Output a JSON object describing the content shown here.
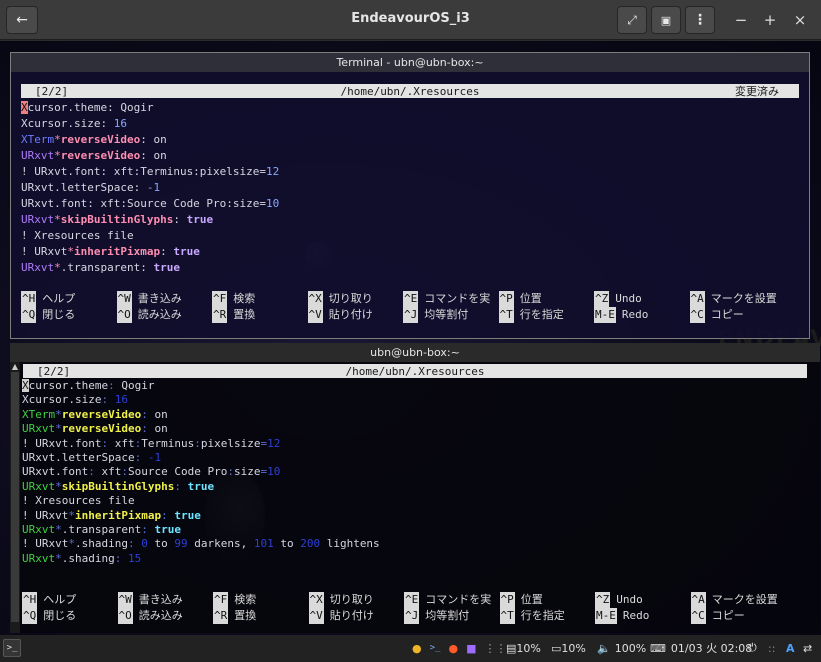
{
  "window": {
    "title": "EndeavourOS_i3",
    "back_icon": "back-arrow-icon",
    "fullscreen_icon": "expand-icon",
    "screenshot_icon": "window-icon",
    "menu_icon": "kebab-menu-icon",
    "minimize": "−",
    "maximize": "+",
    "close": "×"
  },
  "terminal1": {
    "title": "Terminal - ubn@ubn-box:~",
    "nano_buffer": "[2/2]",
    "nano_path": "/home/ubn/.Xresources",
    "nano_status": "変更済み",
    "lines": [
      [
        {
          "t": "X",
          "c": "cursor"
        },
        {
          "t": "cursor.theme: Qogir",
          "c": "w"
        }
      ],
      [
        {
          "t": "Xcursor.size: ",
          "c": "w"
        },
        {
          "t": "16",
          "c": "num"
        }
      ],
      [
        {
          "t": "XTerm",
          "c": "blue"
        },
        {
          "t": "*",
          "c": "pink"
        },
        {
          "t": "reverseVideo",
          "c": "pinkb"
        },
        {
          "t": ": on",
          "c": "w"
        }
      ],
      [
        {
          "t": "URxvt",
          "c": "purple"
        },
        {
          "t": "*",
          "c": "pink"
        },
        {
          "t": "reverseVideo",
          "c": "pinkb"
        },
        {
          "t": ": on",
          "c": "w"
        }
      ],
      [
        {
          "t": "! URxvt.font: xft:Terminus:pixelsize=",
          "c": "w"
        },
        {
          "t": "12",
          "c": "num"
        }
      ],
      [
        {
          "t": "URxvt.letterSpace: ",
          "c": "w"
        },
        {
          "t": "-1",
          "c": "num"
        }
      ],
      [
        {
          "t": "URxvt.font: xft:Source Code Pro:size=",
          "c": "w"
        },
        {
          "t": "10",
          "c": "num"
        }
      ],
      [
        {
          "t": "URxvt",
          "c": "purple"
        },
        {
          "t": "*",
          "c": "pink"
        },
        {
          "t": "skipBuiltinGlyphs",
          "c": "pinkb"
        },
        {
          "t": ": ",
          "c": "w"
        },
        {
          "t": "true",
          "c": "lilacb"
        }
      ],
      [
        {
          "t": "! Xresources file",
          "c": "w"
        }
      ],
      [
        {
          "t": "! URxvt",
          "c": "w"
        },
        {
          "t": "*",
          "c": "pink"
        },
        {
          "t": "inheritPixmap",
          "c": "pinkb"
        },
        {
          "t": ": ",
          "c": "w"
        },
        {
          "t": "true",
          "c": "lilacb"
        }
      ],
      [
        {
          "t": "URxvt",
          "c": "purple"
        },
        {
          "t": "*",
          "c": "pink"
        },
        {
          "t": ".transparent: ",
          "c": "w"
        },
        {
          "t": "true",
          "c": "lilacb"
        }
      ]
    ],
    "shortcuts": [
      [
        [
          "^H",
          "ヘルプ"
        ],
        [
          "^W",
          "書き込み"
        ],
        [
          "^F",
          "検索"
        ],
        [
          "^X",
          "切り取り"
        ],
        [
          "^E",
          "コマンドを実"
        ],
        [
          "^P",
          "位置"
        ],
        [
          "^Z",
          "Undo"
        ],
        [
          "^A",
          "マークを設置"
        ]
      ],
      [
        [
          "^Q",
          "閉じる"
        ],
        [
          "^O",
          "読み込み"
        ],
        [
          "^R",
          "置換"
        ],
        [
          "^V",
          "貼り付け"
        ],
        [
          "^J",
          "均等割付"
        ],
        [
          "^T",
          "行を指定"
        ],
        [
          "M-E",
          "Redo"
        ],
        [
          "^C",
          "コピー"
        ]
      ]
    ]
  },
  "terminal2": {
    "title": "ubn@ubn-box:~",
    "nano_buffer": "[2/2]",
    "nano_path": "/home/ubn/.Xresources",
    "lines": [
      [
        {
          "t": "X",
          "c": "cursor2"
        },
        {
          "t": "cursor.theme",
          "c": "w"
        },
        {
          "t": ":",
          "c": "dim"
        },
        {
          "t": " Qogir",
          "c": "w"
        }
      ],
      [
        {
          "t": "Xcursor.size",
          "c": "w"
        },
        {
          "t": ": ",
          "c": "dim"
        },
        {
          "t": "16",
          "c": "dblue"
        }
      ],
      [
        {
          "t": "XTerm",
          "c": "green"
        },
        {
          "t": "*",
          "c": "dim"
        },
        {
          "t": "reverseVideo",
          "c": "yellowb"
        },
        {
          "t": ":",
          "c": "dim"
        },
        {
          "t": " on",
          "c": "w"
        }
      ],
      [
        {
          "t": "URxvt",
          "c": "green"
        },
        {
          "t": "*",
          "c": "dim"
        },
        {
          "t": "reverseVideo",
          "c": "yellowb"
        },
        {
          "t": ":",
          "c": "dim"
        },
        {
          "t": " on",
          "c": "w"
        }
      ],
      [
        {
          "t": "! URxvt.font",
          "c": "w"
        },
        {
          "t": ":",
          "c": "dim"
        },
        {
          "t": " xft",
          "c": "w"
        },
        {
          "t": ":",
          "c": "dim"
        },
        {
          "t": "Terminus",
          "c": "w"
        },
        {
          "t": ":",
          "c": "dim"
        },
        {
          "t": "pixelsize",
          "c": "w"
        },
        {
          "t": "=",
          "c": "dim"
        },
        {
          "t": "12",
          "c": "dblue"
        }
      ],
      [
        {
          "t": "URxvt.letterSpace",
          "c": "w"
        },
        {
          "t": ": ",
          "c": "dim"
        },
        {
          "t": "-1",
          "c": "dblue"
        }
      ],
      [
        {
          "t": "URxvt.font",
          "c": "w"
        },
        {
          "t": ":",
          "c": "dim"
        },
        {
          "t": " xft",
          "c": "w"
        },
        {
          "t": ":",
          "c": "dim"
        },
        {
          "t": "Source Code Pro",
          "c": "w"
        },
        {
          "t": ":",
          "c": "dim"
        },
        {
          "t": "size",
          "c": "w"
        },
        {
          "t": "=",
          "c": "dim"
        },
        {
          "t": "10",
          "c": "dblue"
        }
      ],
      [
        {
          "t": "URxvt",
          "c": "green"
        },
        {
          "t": "*",
          "c": "dim"
        },
        {
          "t": "skipBuiltinGlyphs",
          "c": "yellowb"
        },
        {
          "t": ": ",
          "c": "dim"
        },
        {
          "t": "true",
          "c": "cyanb"
        }
      ],
      [
        {
          "t": "! Xresources file",
          "c": "w"
        }
      ],
      [
        {
          "t": "! URxvt",
          "c": "w"
        },
        {
          "t": "*",
          "c": "dim"
        },
        {
          "t": "inheritPixmap",
          "c": "yellowb"
        },
        {
          "t": ": ",
          "c": "dim"
        },
        {
          "t": "true",
          "c": "cyanb"
        }
      ],
      [
        {
          "t": "URxvt",
          "c": "green"
        },
        {
          "t": "*",
          "c": "dim"
        },
        {
          "t": ".transparent",
          "c": "w"
        },
        {
          "t": ": ",
          "c": "dim"
        },
        {
          "t": "true",
          "c": "cyanb"
        }
      ],
      [
        {
          "t": "! URxvt",
          "c": "w"
        },
        {
          "t": "*",
          "c": "dim"
        },
        {
          "t": ".shading",
          "c": "w"
        },
        {
          "t": ": ",
          "c": "dim"
        },
        {
          "t": "0",
          "c": "dblue"
        },
        {
          "t": " to ",
          "c": "w"
        },
        {
          "t": "99",
          "c": "dblue"
        },
        {
          "t": " darkens, ",
          "c": "w"
        },
        {
          "t": "101",
          "c": "dblue"
        },
        {
          "t": " to ",
          "c": "w"
        },
        {
          "t": "200",
          "c": "dblue"
        },
        {
          "t": " lightens",
          "c": "w"
        }
      ],
      [
        {
          "t": "URxvt",
          "c": "green"
        },
        {
          "t": "*",
          "c": "dim"
        },
        {
          "t": ".shading",
          "c": "w"
        },
        {
          "t": ": ",
          "c": "dim"
        },
        {
          "t": "15",
          "c": "dblue"
        }
      ]
    ],
    "shortcuts": [
      [
        [
          "^H",
          "ヘルプ"
        ],
        [
          "^W",
          "書き込み"
        ],
        [
          "^F",
          "検索"
        ],
        [
          "^X",
          "切り取り"
        ],
        [
          "^E",
          "コマンドを実"
        ],
        [
          "^P",
          "位置"
        ],
        [
          "^Z",
          "Undo"
        ],
        [
          "^A",
          "マークを設置"
        ]
      ],
      [
        [
          "^Q",
          "閉じる"
        ],
        [
          "^O",
          "読み込み"
        ],
        [
          "^R",
          "置換"
        ],
        [
          "^V",
          "貼り付け"
        ],
        [
          "^J",
          "均等割付"
        ],
        [
          "^T",
          "行を指定"
        ],
        [
          "M-E",
          "Redo"
        ],
        [
          "^C",
          "コピー"
        ]
      ]
    ]
  },
  "wallpaper": {
    "logo_text": "ENDEAVO"
  },
  "taskbar": {
    "terminal_icon": ">_",
    "tray_icons": [
      "chat-icon",
      "terminal-icon",
      "brave-icon",
      "folder-icon",
      "grid-icon"
    ],
    "cpu": "10%",
    "mem": "10%",
    "volume": "100%",
    "datetime": "01/03 火 02:08",
    "power_icon": "power-icon",
    "lang": "A"
  },
  "colors": {
    "w": "#d6d6e2",
    "num": "#8aa6ff",
    "blue": "#6e7cff",
    "pink": "#ff8db0",
    "pinkb": "#ff8db0",
    "purple": "#b07cff",
    "lilacb": "#c9a8ff",
    "dim": "#5a6bd4",
    "dblue": "#2d3fd6",
    "green": "#3fd23f",
    "yellowb": "#f0f04a",
    "cyanb": "#6fe3ff"
  }
}
